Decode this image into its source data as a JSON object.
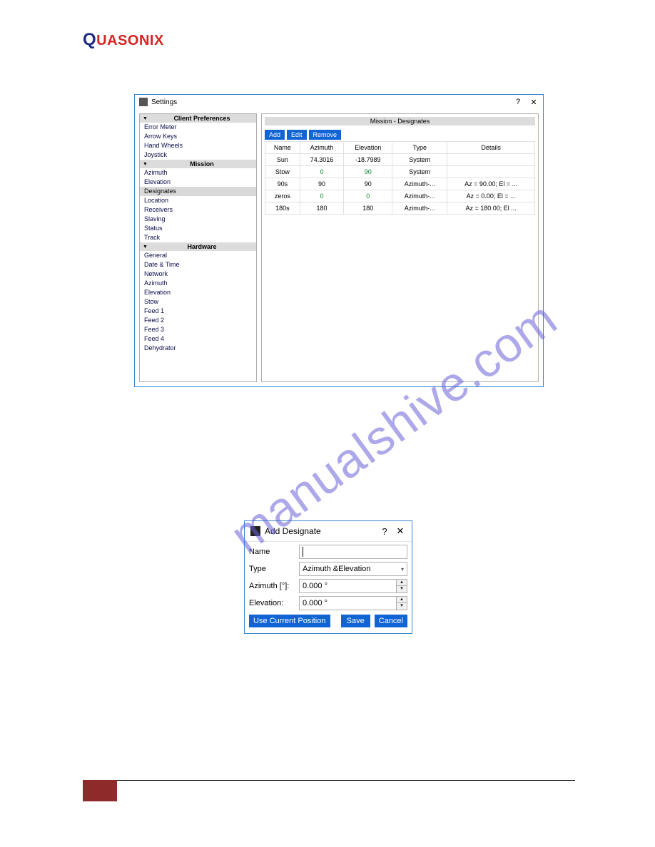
{
  "logo": {
    "q": "Q",
    "rest": "UASONIX"
  },
  "watermark": "manualshive.com",
  "settings": {
    "title": "Settings",
    "help": "?",
    "close": "✕",
    "sections": {
      "client_prefs": {
        "label": "Client Preferences",
        "items": [
          "Error Meter",
          "Arrow Keys",
          "Hand Wheels",
          "Joystick"
        ]
      },
      "mission": {
        "label": "Mission",
        "items": [
          "Azimuth",
          "Elevation",
          "Designates",
          "Location",
          "Receivers",
          "Slaving",
          "Status",
          "Track"
        ],
        "selected": "Designates"
      },
      "hardware": {
        "label": "Hardware",
        "items": [
          "General",
          "Date & Time",
          "Network",
          "Azimuth",
          "Elevation",
          "Stow",
          "Feed 1",
          "Feed 2",
          "Feed 3",
          "Feed 4",
          "Dehydrator"
        ]
      }
    },
    "main": {
      "heading": "Mission - Designates",
      "buttons": {
        "add": "Add",
        "edit": "Edit",
        "remove": "Remove"
      },
      "columns": [
        "Name",
        "Azimuth",
        "Elevation",
        "Type",
        "Details"
      ],
      "rows": [
        {
          "name": "Sun",
          "az": "74.3016",
          "el": "-18.7989",
          "type": "System",
          "details": ""
        },
        {
          "name": "Stow",
          "az": "0",
          "el": "90",
          "type": "System",
          "details": "",
          "green": true
        },
        {
          "name": "90s",
          "az": "90",
          "el": "90",
          "type": "Azimuth-...",
          "details": "Az = 90.00; El = ..."
        },
        {
          "name": "zeros",
          "az": "0",
          "el": "0",
          "type": "Azimuth-...",
          "details": "Az = 0.00; El = ...",
          "green": true
        },
        {
          "name": "180s",
          "az": "180",
          "el": "180",
          "type": "Azimuth-...",
          "details": "Az = 180.00; El ..."
        }
      ]
    }
  },
  "dialog": {
    "title": "Add Designate",
    "help": "?",
    "close": "✕",
    "fields": {
      "name": {
        "label": "Name",
        "value": ""
      },
      "type": {
        "label": "Type",
        "value": "Azimuth &Elevation"
      },
      "azimuth": {
        "label": "Azimuth [°]:",
        "value": "0.000 °"
      },
      "elevation": {
        "label": "Elevation:",
        "value": "0.000 °"
      }
    },
    "buttons": {
      "use_current": "Use Current Position",
      "save": "Save",
      "cancel": "Cancel"
    }
  }
}
